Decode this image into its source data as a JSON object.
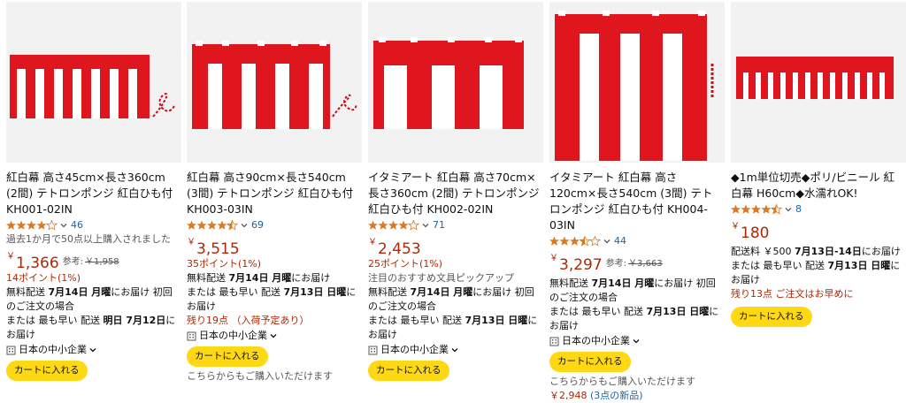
{
  "products": [
    {
      "title": "紅白幕 高さ45cm×長さ360cm (2間) テトロンポンジ 紅白ひも付 KH001-02IN",
      "rating": 4.0,
      "review_count": "46",
      "bought": "過去1か月で50点以上購入されました",
      "price_symbol": "￥",
      "price": "1,366",
      "ref_label": "参考:",
      "list_price": "￥1,958",
      "points": "14ポイント(1%)",
      "delivery1": "無料配送",
      "delivery1_date": "7月14日 月曜",
      "delivery1_suffix": "にお届け 初回のご注文の場合",
      "delivery2_prefix": "または 最も早い 配送",
      "delivery2_date": "明日 7月12日",
      "delivery2_suffix": "にお届け",
      "seller": "日本の中小企業",
      "cart": "カートに入れる"
    },
    {
      "title": "紅白幕 高さ90cm×長さ540cm (3間) テトロンポンジ 紅白ひも付 KH003-03IN",
      "rating": 4.5,
      "review_count": "69",
      "price_symbol": "￥",
      "price": "3,515",
      "points": "35ポイント(1%)",
      "delivery1": "無料配送",
      "delivery1_date": "7月14日 月曜",
      "delivery1_suffix": "にお届け",
      "delivery2_prefix": "または 最も早い 配送",
      "delivery2_date": "7月13日 日曜",
      "delivery2_suffix": "にお届け",
      "stock": "残り19点 （入荷予定あり）",
      "seller": "日本の中小企業",
      "cart": "カートに入れる",
      "also": "こちらからもご購入いただけます"
    },
    {
      "title": "イタミアート 紅白幕 高さ70cm×長さ360cm (2間) テトロンポンジ 紅白ひも付 KH002-02IN",
      "rating": 4.0,
      "review_count": "71",
      "price_symbol": "￥",
      "price": "2,453",
      "points": "25ポイント(1%)",
      "pickup": "注目のおすすめ文具ピックアップ",
      "delivery1": "無料配送",
      "delivery1_date": "7月14日 月曜",
      "delivery1_suffix": "にお届け 初回のご注文の場合",
      "delivery2_prefix": "または 最も早い 配送",
      "delivery2_date": "7月13日 日曜",
      "delivery2_suffix": "にお届け",
      "seller": "日本の中小企業",
      "cart": "カートに入れる"
    },
    {
      "title": "イタミアート 紅白幕 高さ120cm×長さ540cm (3間) テトロンポンジ 紅白ひも付 KH004-03IN",
      "rating": 3.5,
      "review_count": "44",
      "price_symbol": "￥",
      "price": "3,297",
      "ref_label": "参考:",
      "list_price": "￥3,663",
      "delivery1": "無料配送",
      "delivery1_date": "7月14日 月曜",
      "delivery1_suffix": "にお届け 初回のご注文の場合",
      "delivery2_prefix": "または 最も早い 配送",
      "delivery2_date": "7月13日 日曜",
      "delivery2_suffix": "にお届け",
      "seller": "日本の中小企業",
      "cart": "カートに入れる",
      "also": "こちらからもご購入いただけます",
      "also_price": "￥2,948",
      "also_offers": "(3点の新品)"
    },
    {
      "title": "◆1m単位切売◆ポリ/ビニール 紅白幕 H60cm◆水濡れOK!",
      "rating": 4.5,
      "review_count": "8",
      "price_symbol": "￥",
      "price": "180",
      "shipping_prefix": "配送料 ￥500",
      "shipping_date": "7月13日-14日",
      "shipping_suffix": "にお届け",
      "delivery2_prefix": "または 最も早い 配送",
      "delivery2_date": "7月13日 日曜",
      "delivery2_suffix": "にお届け",
      "stock": "残り13点 ご注文はお早めに",
      "cart": "カートに入れる"
    }
  ],
  "colors": {
    "accent_red": "#b12704",
    "banner_red": "#e0161e",
    "cart_yellow": "#ffd814",
    "link_blue": "#2162a1",
    "star_orange": "#de7921"
  }
}
